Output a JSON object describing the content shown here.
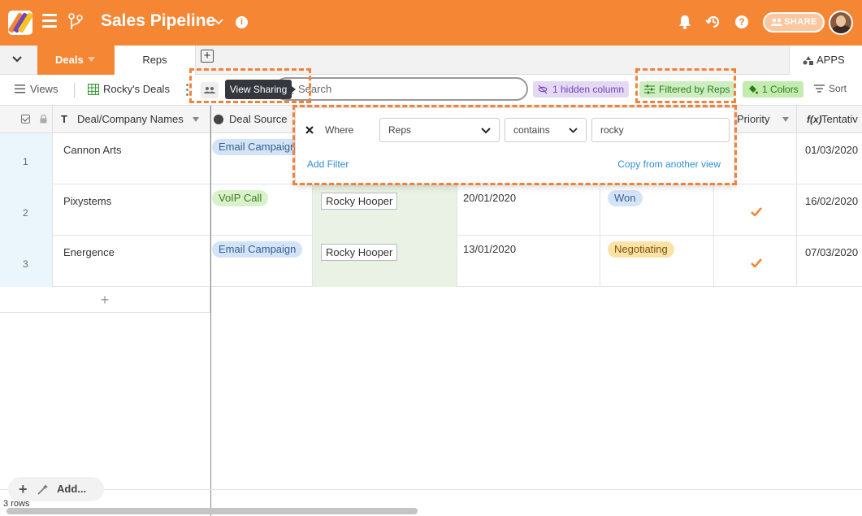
{
  "app": {
    "title": "Sales Pipeline",
    "share_label": "SHARE",
    "brand_color": "#f58634"
  },
  "tabs": {
    "active": "Deals",
    "other": "Reps",
    "apps_label": "APPS"
  },
  "toolbar": {
    "views_label": "Views",
    "view_name": "Rocky's Deals",
    "tooltip": "View Sharing",
    "search_placeholder": "Search",
    "hidden_columns": "1 hidden column",
    "filtered_by": "Filtered by Reps",
    "colors": "1 Colors",
    "sort": "Sort"
  },
  "columns": {
    "name": "Deal/Company Names",
    "source": "Deal Source",
    "priority": "Priority",
    "tentative": "Tentativ"
  },
  "rows": [
    {
      "num": "1",
      "name": "Cannon Arts",
      "source": "Email Campaign",
      "rep": "",
      "date": "",
      "stage": "",
      "priority": false,
      "tentative": "01/03/2020"
    },
    {
      "num": "2",
      "name": "Pixystems",
      "source": "VoIP Call",
      "rep": "Rocky Hooper",
      "date": "20/01/2020",
      "stage": "Won",
      "priority": true,
      "tentative": "16/02/2020"
    },
    {
      "num": "3",
      "name": "Energence",
      "source": "Email Campaign",
      "rep": "Rocky Hooper",
      "date": "13/01/2020",
      "stage": "Negotiating",
      "priority": true,
      "tentative": "07/03/2020"
    }
  ],
  "filter": {
    "where": "Where",
    "field": "Reps",
    "operator": "contains",
    "value": "rocky",
    "add_label": "Add Filter",
    "copy_label": "Copy from another view"
  },
  "footer": {
    "add_label": "Add...",
    "row_count": "3 rows"
  }
}
